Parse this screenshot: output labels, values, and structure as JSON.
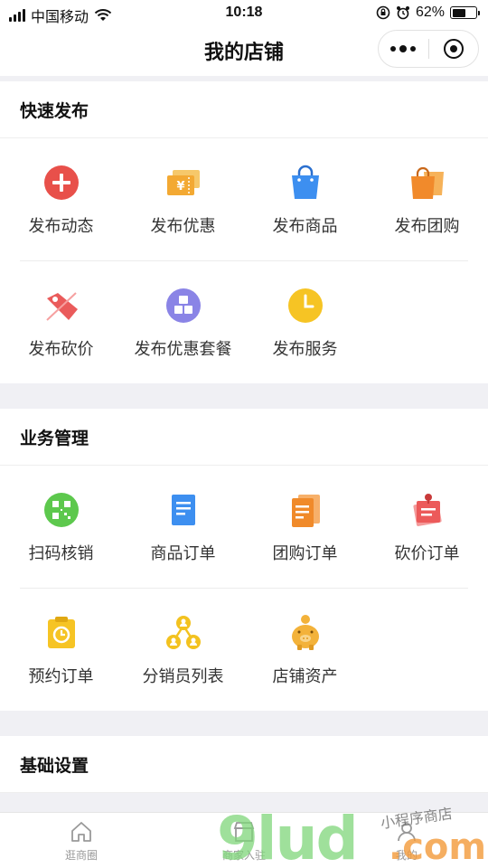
{
  "status_bar": {
    "carrier": "中国移动",
    "time": "10:18",
    "battery": "62%",
    "battery_level": 0.62,
    "icons": [
      "signal-icon",
      "wifi-icon",
      "lock-rotation-icon",
      "alarm-icon",
      "battery-icon"
    ]
  },
  "nav": {
    "title": "我的店铺",
    "icons": [
      "more-icon",
      "close-icon"
    ]
  },
  "sections": {
    "quick_publish": {
      "title": "快速发布",
      "items": [
        {
          "label": "发布动态",
          "icon": "add-circle-icon",
          "color": "#e8504a"
        },
        {
          "label": "发布优惠",
          "icon": "coupon-icon",
          "color": "#f3a933"
        },
        {
          "label": "发布商品",
          "icon": "shopping-bag-icon",
          "color": "#3d8ff0"
        },
        {
          "label": "发布团购",
          "icon": "group-bags-icon",
          "color": "#f18a2b"
        },
        {
          "label": "发布砍价",
          "icon": "price-tag-icon",
          "color": "#ea5b5b"
        },
        {
          "label": "发布优惠套餐",
          "icon": "cubes-icon",
          "color": "#8a84e6"
        },
        {
          "label": "发布服务",
          "icon": "clock-icon",
          "color": "#f6c424"
        }
      ]
    },
    "business": {
      "title": "业务管理",
      "items": [
        {
          "label": "扫码核销",
          "icon": "qr-scan-icon",
          "color": "#5dc84d"
        },
        {
          "label": "商品订单",
          "icon": "document-icon",
          "color": "#3d8ff0"
        },
        {
          "label": "团购订单",
          "icon": "stacked-docs-icon",
          "color": "#f08a2a"
        },
        {
          "label": "砍价订单",
          "icon": "pinned-note-icon",
          "color": "#ec5a5a"
        },
        {
          "label": "预约订单",
          "icon": "clipboard-clock-icon",
          "color": "#f6c424"
        },
        {
          "label": "分销员列表",
          "icon": "people-network-icon",
          "color": "#f3c21f"
        },
        {
          "label": "店铺资产",
          "icon": "piggy-bank-icon",
          "color": "#f3b23a"
        }
      ]
    },
    "basic": {
      "title": "基础设置"
    }
  },
  "tabbar": {
    "tabs": [
      {
        "label": "逛商圈",
        "icon": "home-icon"
      },
      {
        "label": "商家入驻",
        "icon": "store-icon"
      },
      {
        "label": "我的",
        "icon": "user-icon"
      }
    ]
  },
  "watermark": {
    "text": "9lud",
    "suffix": ".com",
    "tagline": "小程序商店"
  }
}
